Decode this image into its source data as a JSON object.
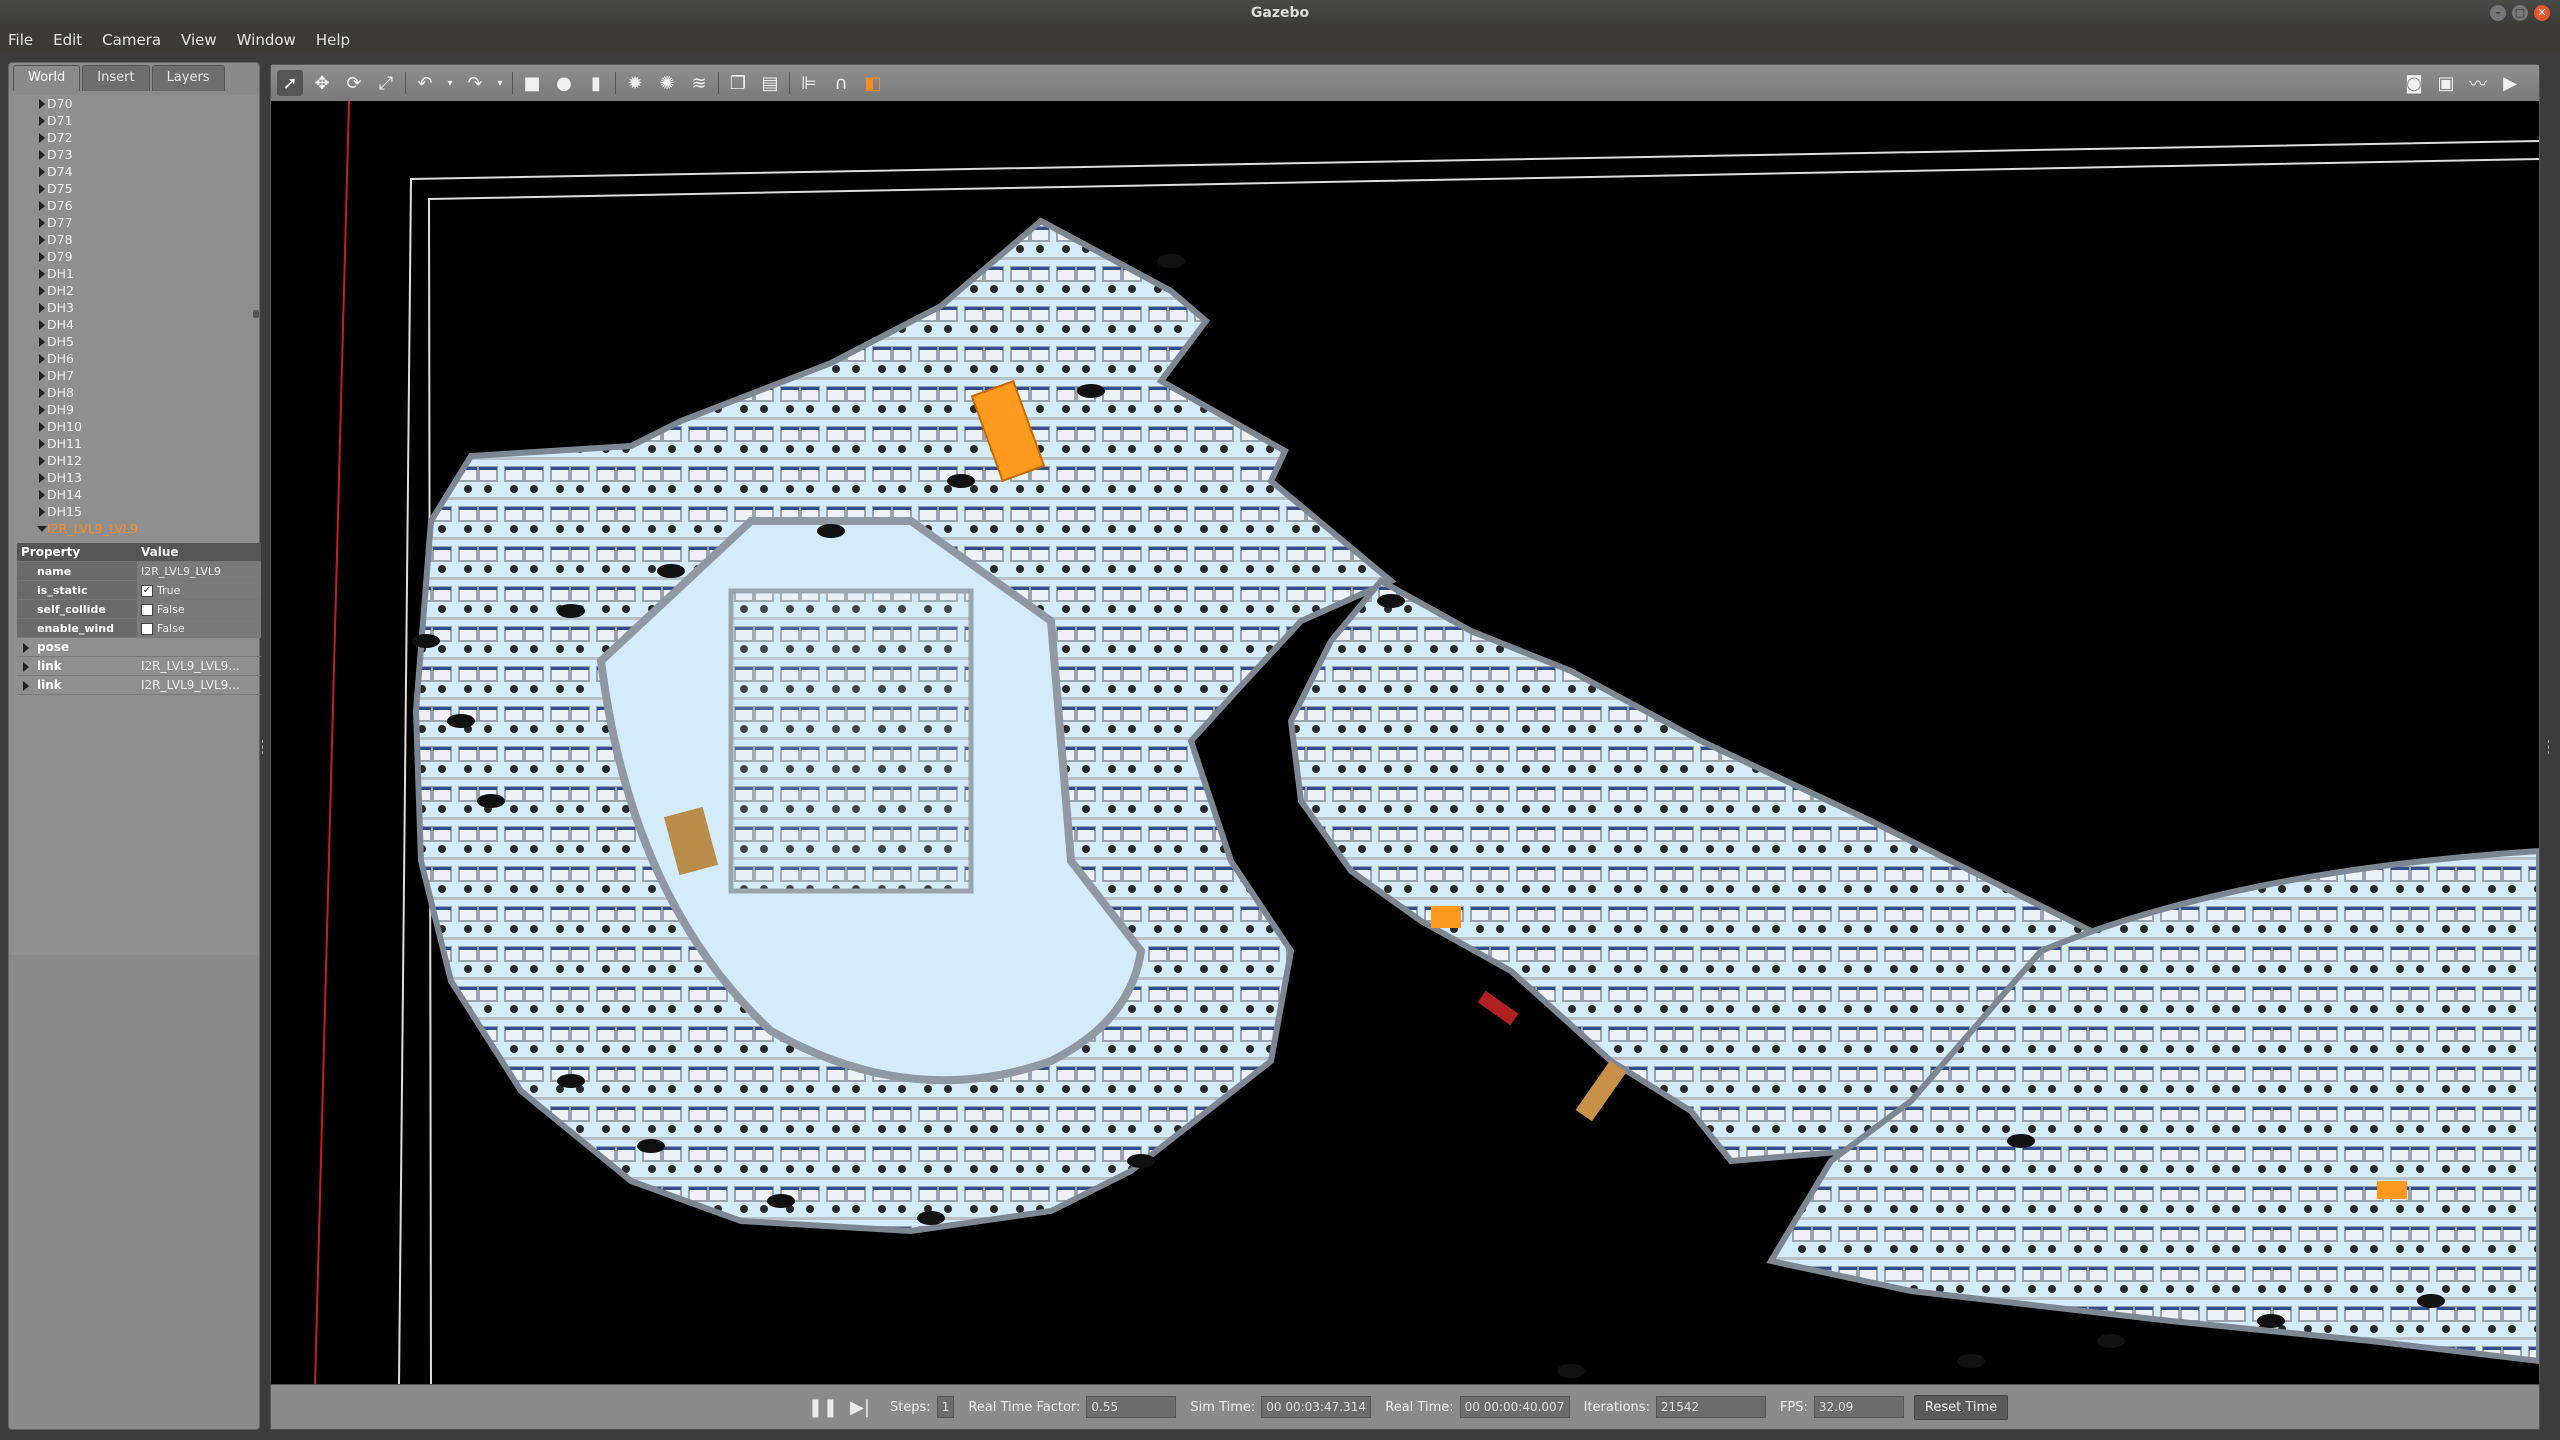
{
  "window": {
    "title": "Gazebo"
  },
  "menu": [
    "File",
    "Edit",
    "Camera",
    "View",
    "Window",
    "Help"
  ],
  "left_tabs": [
    "World",
    "Insert",
    "Layers"
  ],
  "tree_items": [
    "D70",
    "D71",
    "D72",
    "D73",
    "D74",
    "D75",
    "D76",
    "D77",
    "D78",
    "D79",
    "DH1",
    "DH2",
    "DH3",
    "DH4",
    "DH5",
    "DH6",
    "DH7",
    "DH8",
    "DH9",
    "DH10",
    "DH11",
    "DH12",
    "DH13",
    "DH14",
    "DH15"
  ],
  "selected_model": "I2R_LVL9_LVL9",
  "properties": {
    "header_property": "Property",
    "header_value": "Value",
    "rows": [
      {
        "key": "name",
        "value": "I2R_LVL9_LVL9"
      },
      {
        "key": "is_static",
        "value": "True",
        "checked": true
      },
      {
        "key": "self_collide",
        "value": "False",
        "checked": false
      },
      {
        "key": "enable_wind",
        "value": "False",
        "checked": false
      }
    ],
    "expand_rows": [
      {
        "key": "pose",
        "value": ""
      },
      {
        "key": "link",
        "value": "I2R_LVL9_LVL9..."
      },
      {
        "key": "link",
        "value": "I2R_LVL9_LVL9..."
      }
    ]
  },
  "toolbar_icons": [
    "select-arrow-icon",
    "translate-icon",
    "rotate-icon",
    "scale-icon",
    "undo-icon",
    "undo-dropdown-icon",
    "redo-icon",
    "redo-dropdown-icon",
    "box-icon",
    "sphere-icon",
    "cylinder-icon",
    "point-light-icon",
    "spot-light-icon",
    "directional-light-icon",
    "copy-icon",
    "paste-icon",
    "align-icon",
    "snap-icon",
    "view-angle-icon"
  ],
  "toolbar_right_icons": [
    "screenshot-icon",
    "log-icon",
    "plot-icon",
    "record-video-icon"
  ],
  "bottom": {
    "steps_label": "Steps:",
    "steps_value": "1",
    "rtf_label": "Real Time Factor:",
    "rtf_value": "0.55",
    "sim_time_label": "Sim Time:",
    "sim_time_value": "00 00:03:47.314",
    "real_time_label": "Real Time:",
    "real_time_value": "00 00:00:40.007",
    "iterations_label": "Iterations:",
    "iterations_value": "21542",
    "fps_label": "FPS:",
    "fps_value": "32.09",
    "reset_label": "Reset Time"
  },
  "colors": {
    "floor": "#d4ecfa",
    "wall": "#8f98a3",
    "background": "#000000",
    "accent": "#ff8a1c"
  }
}
